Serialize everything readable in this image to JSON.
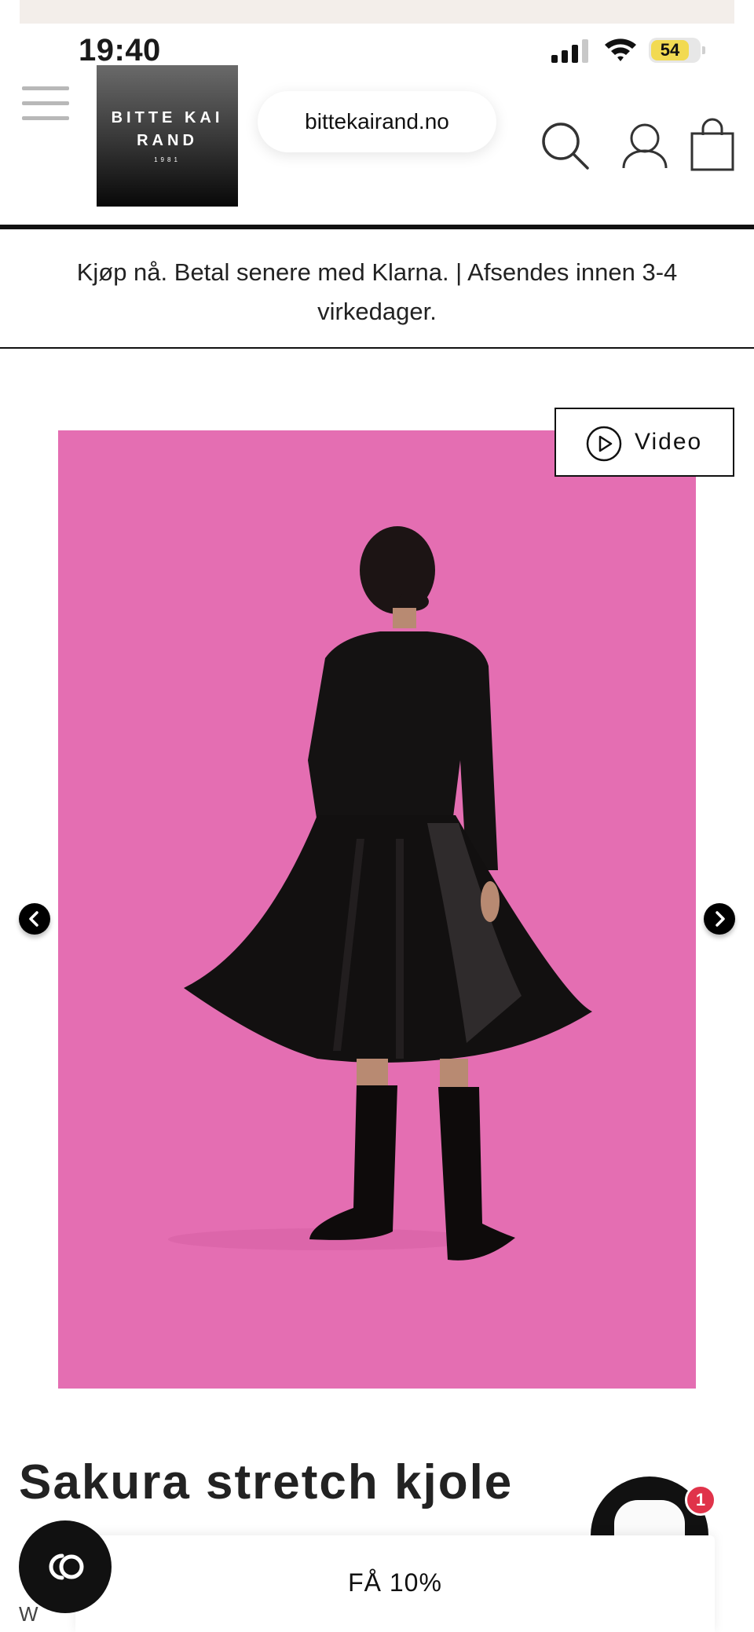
{
  "status_bar": {
    "time": "19:40",
    "battery": "54"
  },
  "browser": {
    "url": "bittekairand.no"
  },
  "header": {
    "logo_line1": "BITTE KAI",
    "logo_line2": "RAND",
    "logo_year": "1981"
  },
  "promo": {
    "text": "Kjøp nå. Betal senere med Klarna. | Afsendes innen 3-4 virkedager."
  },
  "gallery": {
    "video_label": "Video"
  },
  "product": {
    "title": "Sakura stretch kjole"
  },
  "chat": {
    "unread_count": "1"
  },
  "discount": {
    "label": "FÅ 10%"
  },
  "partial_text": "W",
  "colors": {
    "image_background": "#e46eb2",
    "badge": "#e0334a",
    "battery_fill": "#f2da52"
  }
}
